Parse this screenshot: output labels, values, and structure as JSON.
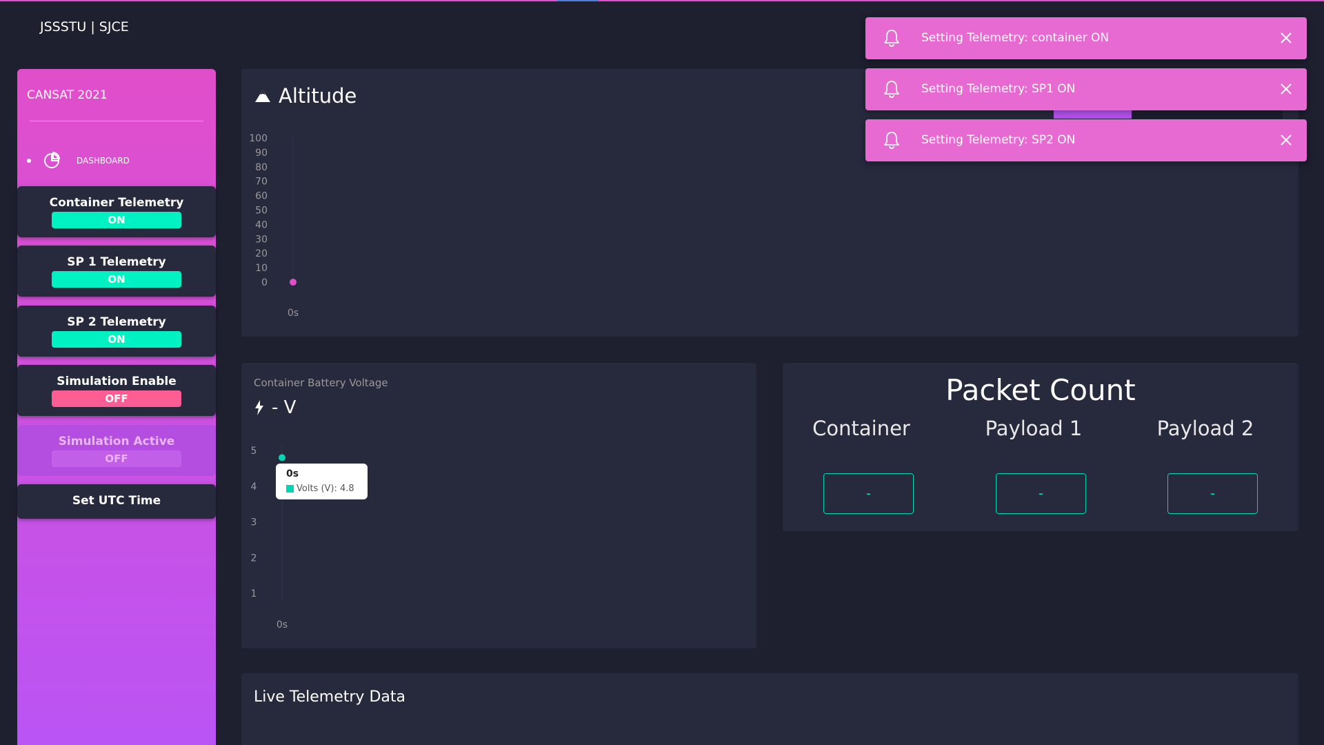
{
  "brand": "JSSSTU | SJCE",
  "sidebar": {
    "title": "CANSAT 2021",
    "nav_dashboard": "DASHBOARD",
    "buttons": [
      {
        "label": "Container Telemetry",
        "state": "ON"
      },
      {
        "label": "SP 1 Telemetry",
        "state": "ON"
      },
      {
        "label": "SP 2 Telemetry",
        "state": "ON"
      },
      {
        "label": "Simulation Enable",
        "state": "OFF"
      },
      {
        "label": "Simulation Active",
        "state": "OFF"
      }
    ],
    "set_utc": "Set UTC Time"
  },
  "altitude": {
    "title": "Altitude",
    "chart_data": {
      "type": "line",
      "x": [
        "0s"
      ],
      "values": [
        0
      ],
      "ylim": [
        0,
        100
      ],
      "yticks": [
        "100",
        "90",
        "80",
        "70",
        "60",
        "50",
        "40",
        "30",
        "20",
        "10",
        "0"
      ],
      "xticks": [
        "0s"
      ],
      "color": "#e14eca"
    }
  },
  "battery": {
    "subtitle": "Container Battery Voltage",
    "value_text": "- V",
    "tooltip": {
      "title": "0s",
      "label": "Volts (V): 4.8"
    },
    "chart_data": {
      "type": "line",
      "x": [
        "0s"
      ],
      "values": [
        4.8
      ],
      "yticks": [
        "5",
        "4",
        "3",
        "2",
        "1"
      ],
      "xticks": [
        "0s"
      ],
      "color": "#00d6b4"
    }
  },
  "packet_count": {
    "title": "Packet Count",
    "columns": [
      {
        "label": "Container",
        "value": "-"
      },
      {
        "label": "Payload 1",
        "value": "-"
      },
      {
        "label": "Payload 2",
        "value": "-"
      }
    ]
  },
  "live": {
    "title": "Live Telemetry Data"
  },
  "toasts": [
    {
      "message": "Setting Telemetry: container ON"
    },
    {
      "message": "Setting Telemetry: SP1 ON"
    },
    {
      "message": "Setting Telemetry: SP2 ON"
    }
  ],
  "colors": {
    "background": "#1e1f2f",
    "card": "#27293d",
    "accent_pink": "#e14eca",
    "accent_purple": "#ba54f5",
    "on_green": "#00f2c3",
    "off_red": "#fd5d93",
    "toast": "#e66ad2"
  }
}
